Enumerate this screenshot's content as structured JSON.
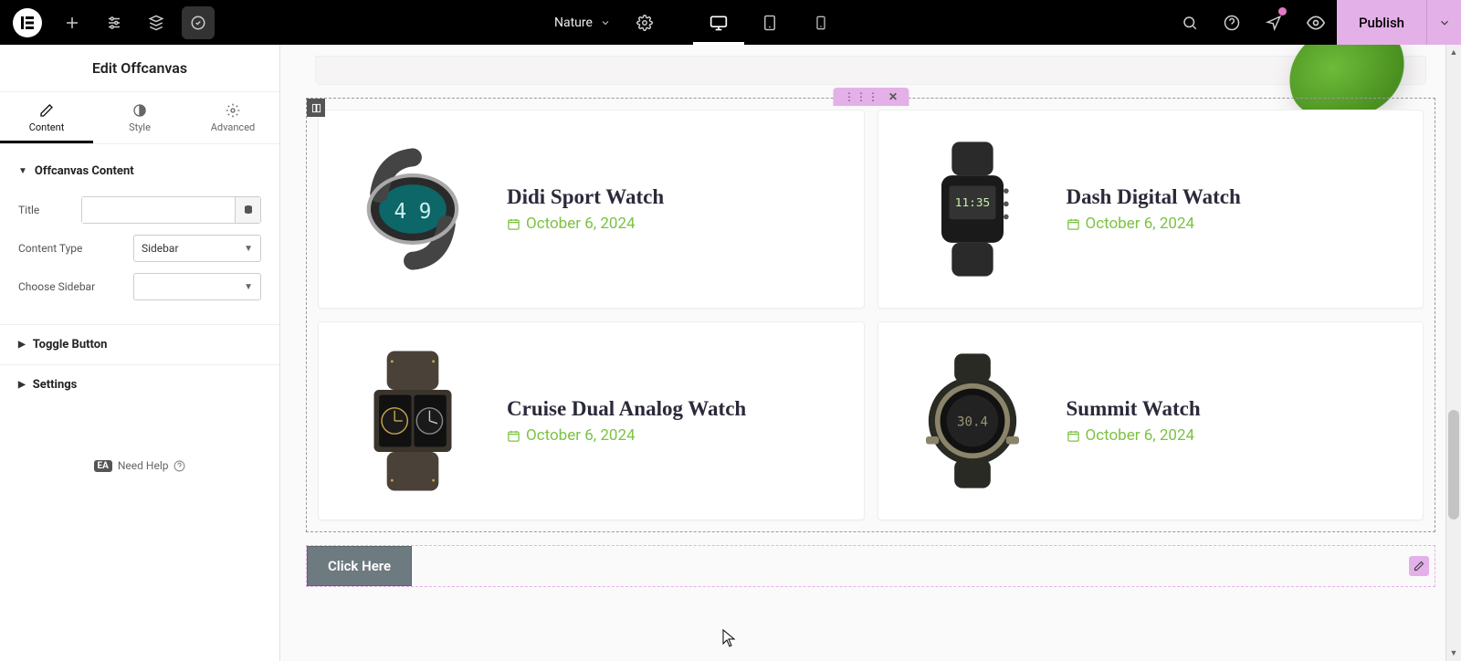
{
  "topbar": {
    "theme_name": "Nature",
    "publish_label": "Publish"
  },
  "sidebar": {
    "title": "Edit Offcanvas",
    "tabs": {
      "content": "Content",
      "style": "Style",
      "advanced": "Advanced"
    },
    "sections": {
      "offcanvas_content": "Offcanvas Content",
      "toggle_button": "Toggle Button",
      "settings": "Settings"
    },
    "fields": {
      "title_label": "Title",
      "title_value": "",
      "content_type_label": "Content Type",
      "content_type_value": "Sidebar",
      "choose_sidebar_label": "Choose Sidebar",
      "choose_sidebar_value": ""
    },
    "help": "Need Help",
    "help_badge": "EA"
  },
  "canvas": {
    "products": [
      {
        "title": "Didi Sport Watch",
        "date": "October 6, 2024"
      },
      {
        "title": "Dash Digital Watch",
        "date": "October 6, 2024"
      },
      {
        "title": "Cruise Dual Analog Watch",
        "date": "October 6, 2024"
      },
      {
        "title": "Summit Watch",
        "date": "October 6, 2024"
      }
    ],
    "button_label": "Click Here"
  }
}
